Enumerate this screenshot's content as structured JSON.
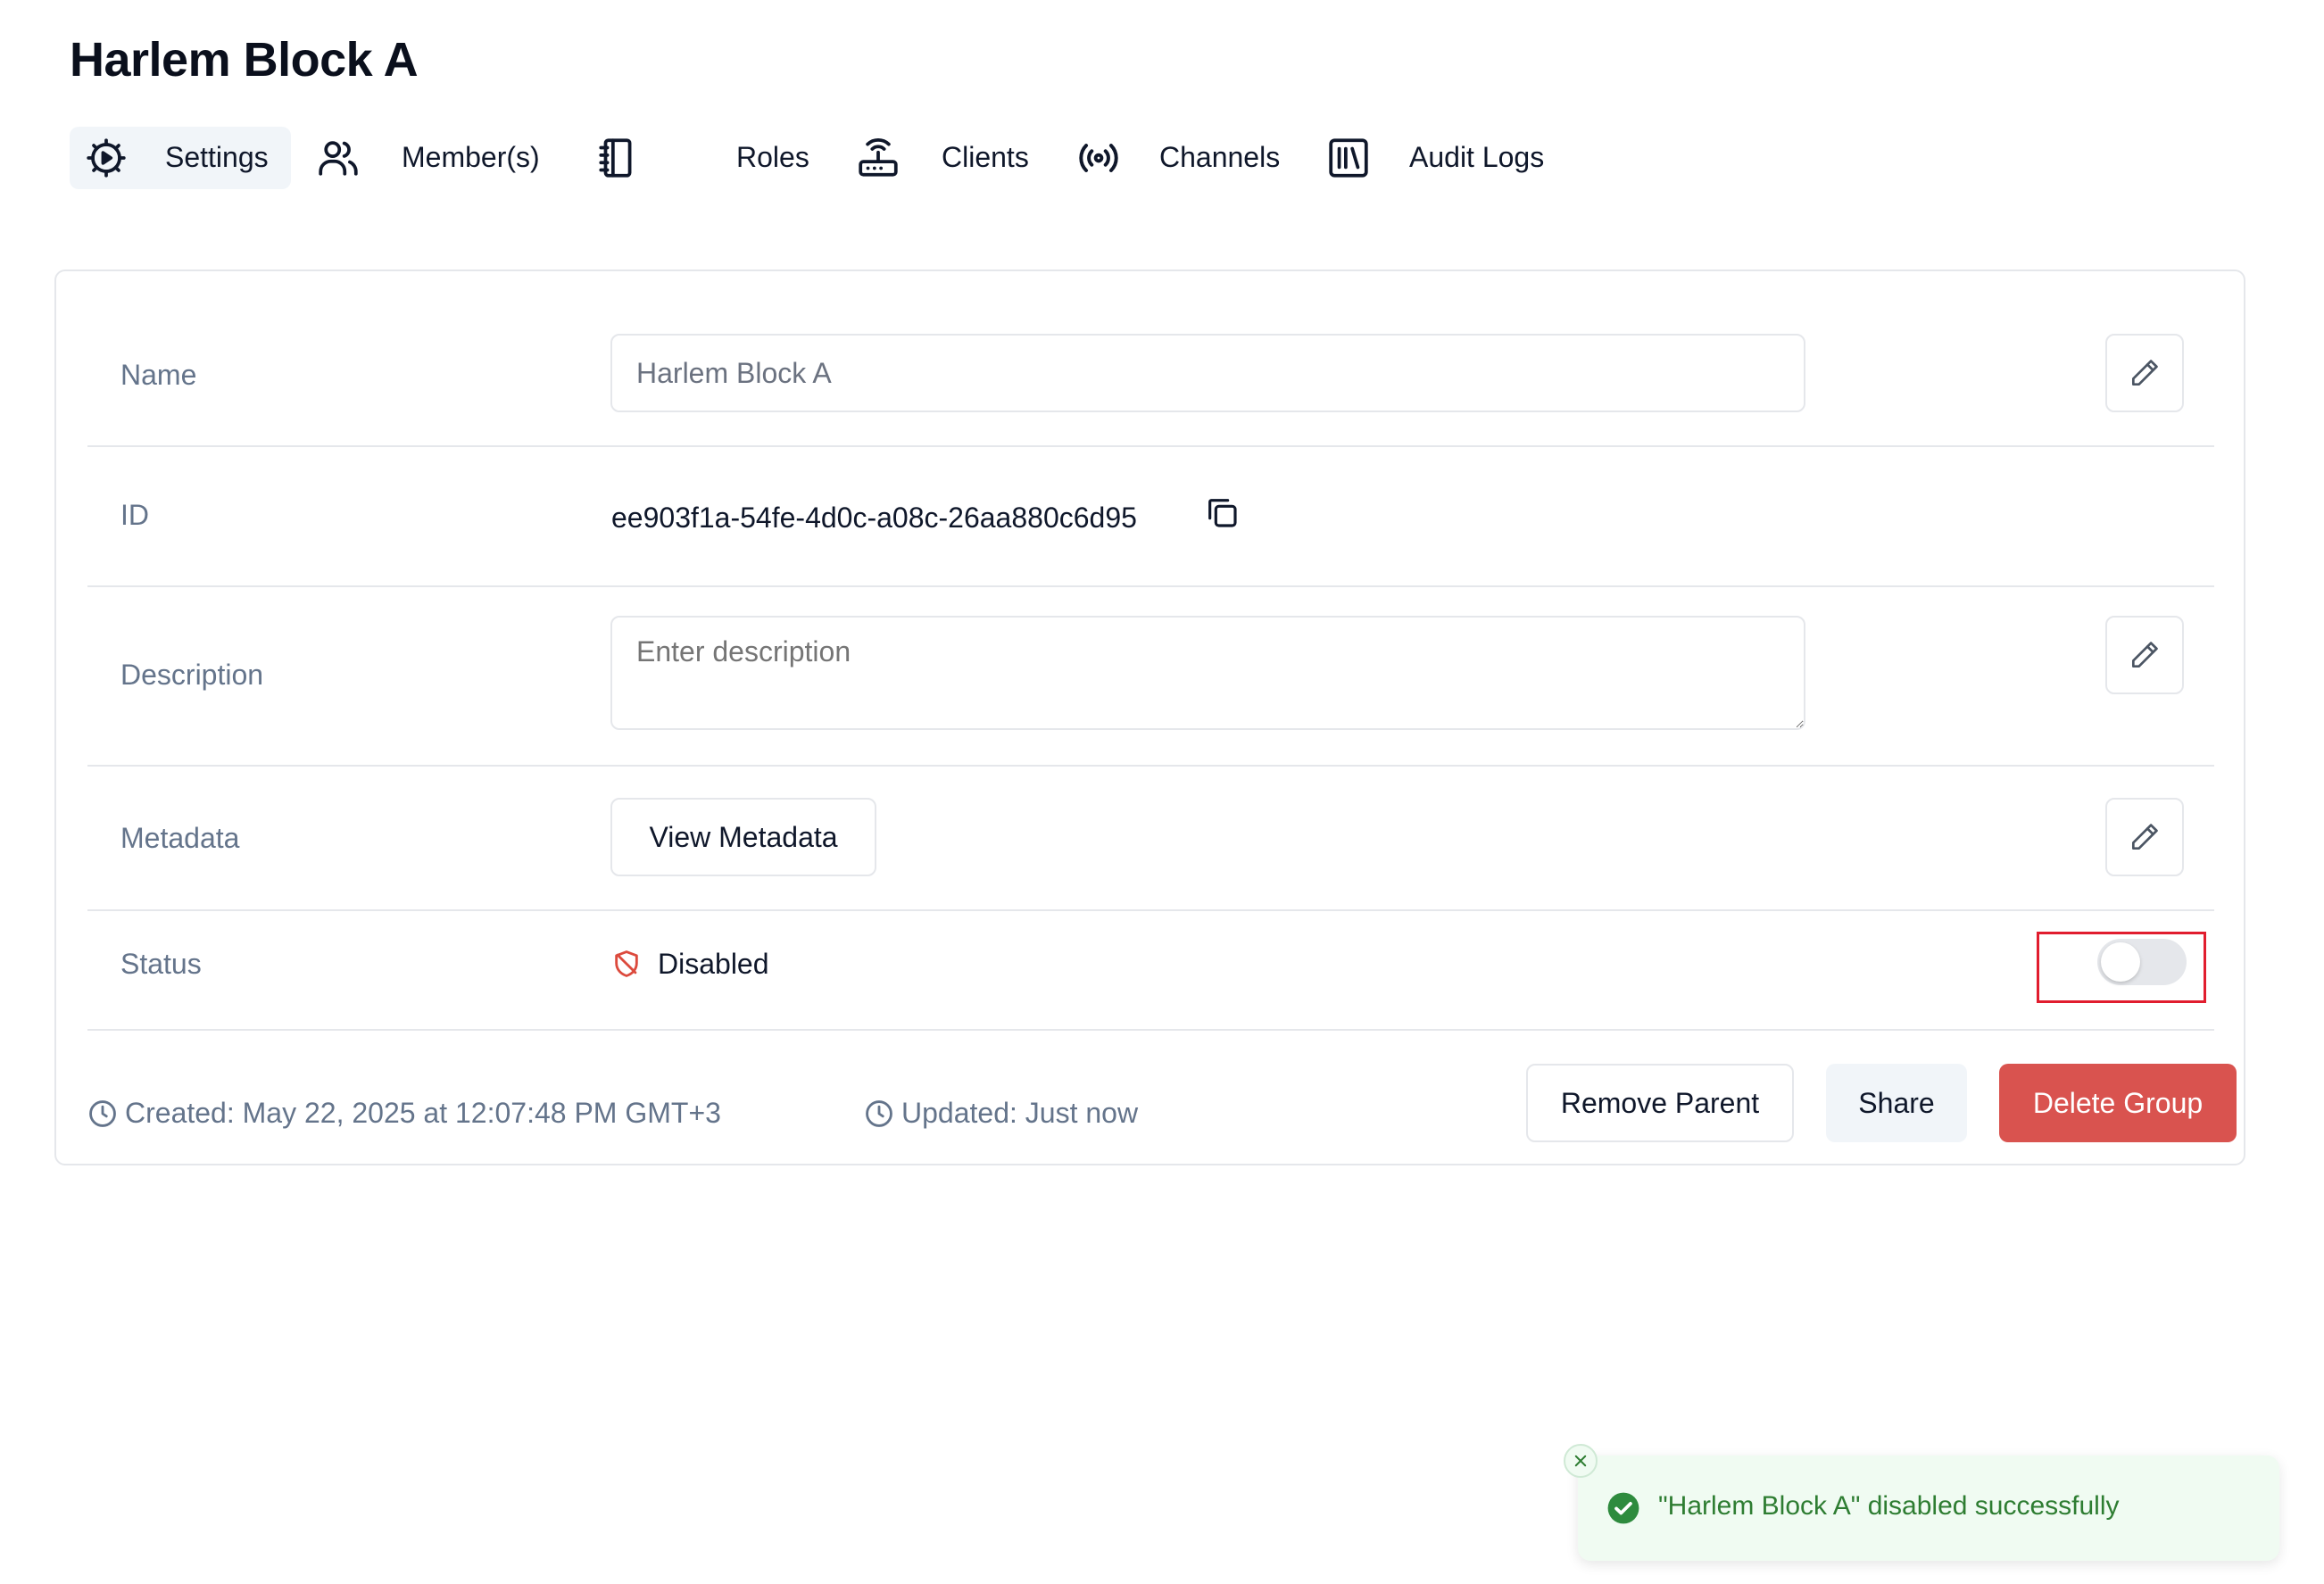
{
  "page": {
    "title": "Harlem Block A"
  },
  "tabs": [
    {
      "label": "Settings",
      "icon": "settings-gear-icon",
      "active": true
    },
    {
      "label": "Member(s)",
      "icon": "users-icon"
    },
    {
      "label": "Roles",
      "icon": "notebook-icon"
    },
    {
      "label": "Clients",
      "icon": "router-icon"
    },
    {
      "label": "Channels",
      "icon": "radio-broadcast-icon"
    },
    {
      "label": "Audit Logs",
      "icon": "library-icon"
    }
  ],
  "fields": {
    "name": {
      "label": "Name",
      "value": "Harlem Block A"
    },
    "id": {
      "label": "ID",
      "value": "ee903f1a-54fe-4d0c-a08c-26aa880c6d95"
    },
    "description": {
      "label": "Description",
      "value": "",
      "placeholder": "Enter description"
    },
    "metadata": {
      "label": "Metadata",
      "button_label": "View Metadata"
    },
    "status": {
      "label": "Status",
      "value": "Disabled",
      "enabled": false
    }
  },
  "footer": {
    "created": "Created: May 22, 2025 at 12:07:48 PM GMT+3",
    "updated": "Updated: Just now",
    "remove_parent_label": "Remove Parent",
    "share_label": "Share",
    "delete_label": "Delete Group"
  },
  "toast": {
    "message": "\"Harlem Block A\" disabled successfully",
    "type": "success"
  },
  "colors": {
    "danger": "#d9534f",
    "success_text": "#2e7d32",
    "success_bg": "#f0fbf2",
    "highlight": "#e11d2e"
  }
}
